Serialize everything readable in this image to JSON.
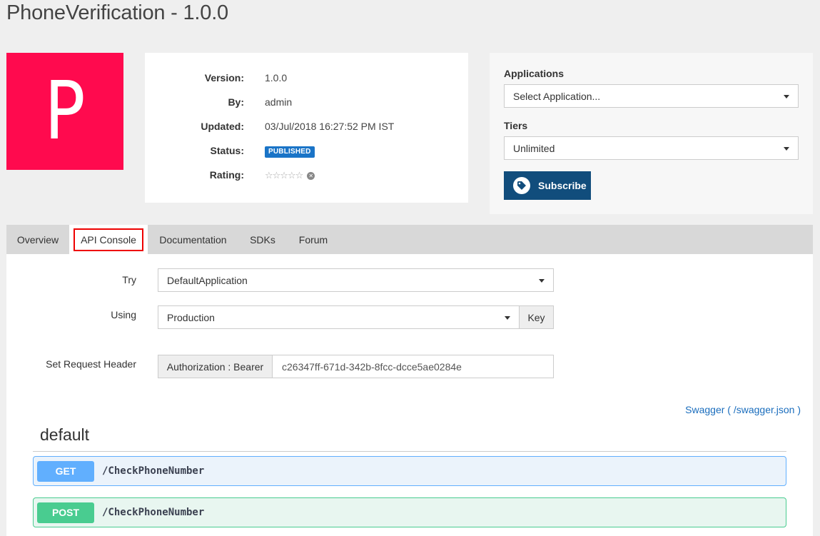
{
  "page": {
    "title": "PhoneVerification - 1.0.0"
  },
  "avatar": {
    "letter": "P",
    "color": "#ff0a4e"
  },
  "info": {
    "version_label": "Version:",
    "version": "1.0.0",
    "by_label": "By:",
    "by": "admin",
    "updated_label": "Updated:",
    "updated": "03/Jul/2018 16:27:52 PM IST",
    "status_label": "Status:",
    "status": "PUBLISHED",
    "rating_label": "Rating:",
    "rating_stars": "☆☆☆☆☆",
    "rating_value": 0
  },
  "subscribe": {
    "applications_label": "Applications",
    "application_selected": "Select Application...",
    "tiers_label": "Tiers",
    "tier_selected": "Unlimited",
    "button_label": "Subscribe"
  },
  "tabs": [
    {
      "label": "Overview",
      "active": false
    },
    {
      "label": "API Console",
      "active": true
    },
    {
      "label": "Documentation",
      "active": false
    },
    {
      "label": "SDKs",
      "active": false
    },
    {
      "label": "Forum",
      "active": false
    }
  ],
  "console": {
    "try_label": "Try",
    "try_selected": "DefaultApplication",
    "using_label": "Using",
    "using_selected": "Production",
    "key_button": "Key",
    "header_label": "Set Request Header",
    "header_prefix": "Authorization : Bearer",
    "header_token": "c26347ff-671d-342b-8fcc-dcce5ae0284e",
    "swagger_link": "Swagger ( /swagger.json )"
  },
  "swagger": {
    "group": "default",
    "operations": [
      {
        "method": "GET",
        "path": "/CheckPhoneNumber",
        "color": "#61affe"
      },
      {
        "method": "POST",
        "path": "/CheckPhoneNumber",
        "color": "#49cc90"
      }
    ]
  }
}
